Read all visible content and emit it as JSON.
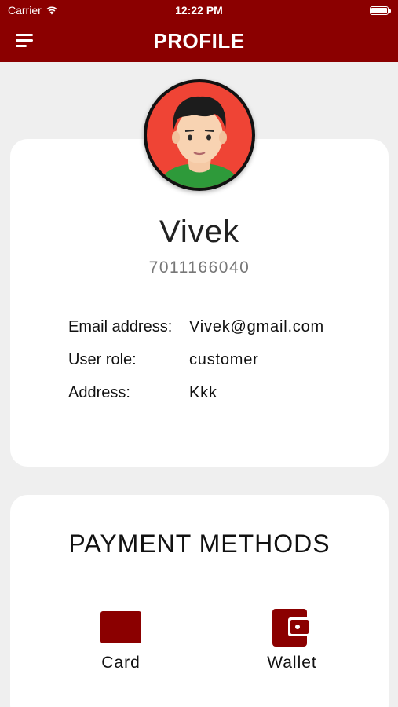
{
  "status_bar": {
    "carrier": "Carrier",
    "time": "12:22 PM"
  },
  "header": {
    "title": "PROFILE"
  },
  "profile": {
    "name": "Vivek",
    "phone": "7011166040",
    "fields": [
      {
        "label": "Email address:",
        "value": "Vivek@gmail.com"
      },
      {
        "label": "User role:",
        "value": "customer"
      },
      {
        "label": "Address:",
        "value": "Kkk"
      }
    ]
  },
  "payment": {
    "title": "PAYMENT METHODS",
    "methods": [
      {
        "label": "Card",
        "icon": "credit-card-icon"
      },
      {
        "label": "Wallet",
        "icon": "wallet-icon"
      }
    ]
  },
  "colors": {
    "brand": "#8b0000",
    "background": "#efefef",
    "avatar_bg": "#ef4435"
  }
}
